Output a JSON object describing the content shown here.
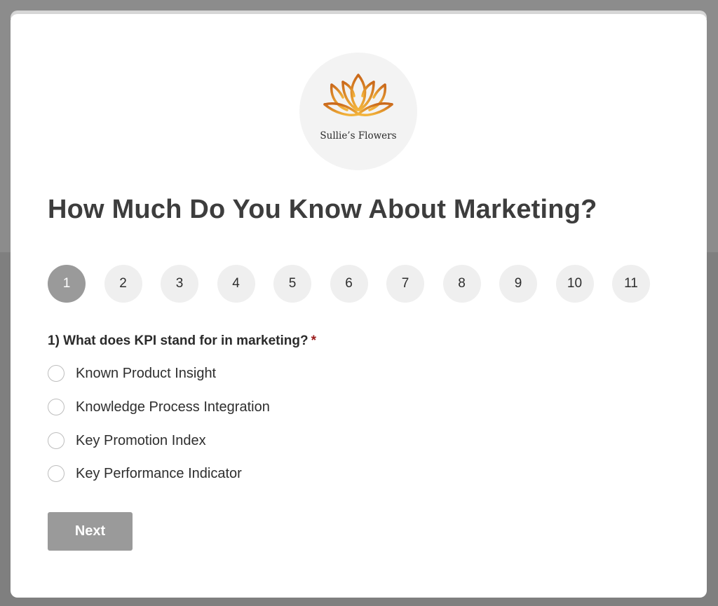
{
  "brand": {
    "name": "Sullie’s Flowers",
    "logo_icon": "lotus-icon",
    "colors": {
      "petal_dark": "#c9671a",
      "petal_light": "#f3b43b"
    }
  },
  "quiz": {
    "title": "How Much Do You Know About Marketing?",
    "steps": [
      "1",
      "2",
      "3",
      "4",
      "5",
      "6",
      "7",
      "8",
      "9",
      "10",
      "11"
    ],
    "current_step": 1,
    "question": {
      "text": "1) What does KPI stand for in marketing?",
      "required_mark": "*",
      "options": [
        "Known Product Insight",
        "Knowledge Process Integration",
        "Key Promotion Index",
        "Key Performance Indicator"
      ],
      "selected": null
    },
    "next_label": "Next"
  },
  "colors": {
    "accent_gray": "#9a9a9a",
    "required_red": "#9b1c1c",
    "title_text": "#3d3d3d"
  }
}
